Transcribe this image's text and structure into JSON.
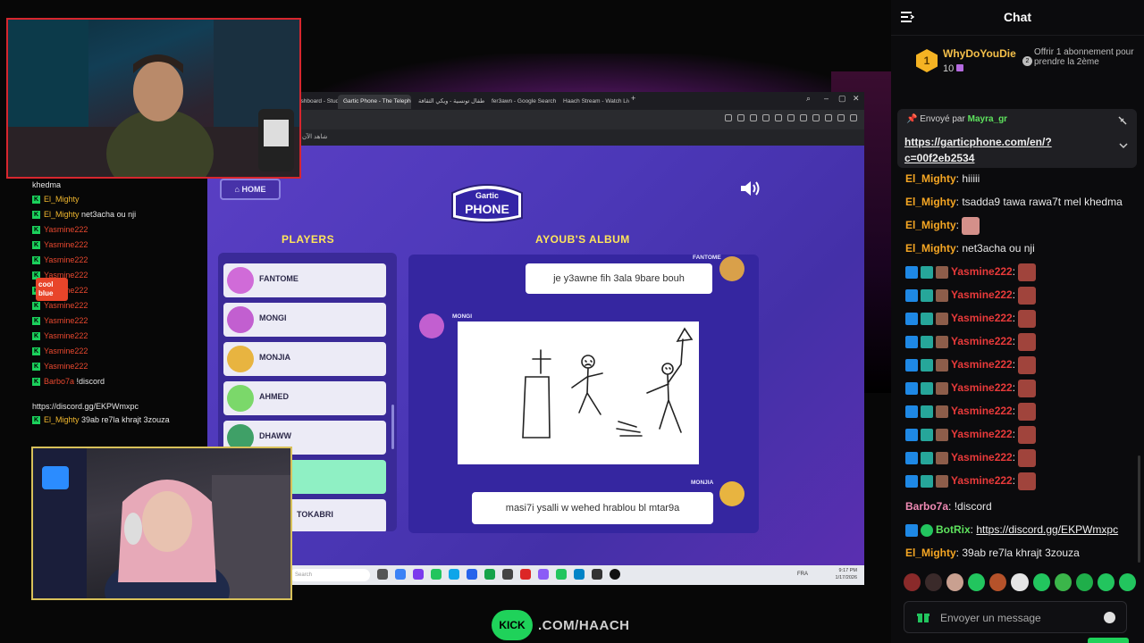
{
  "browser": {
    "tabs": [
      {
        "label": "Twitch Dashboard - Studio for store"
      },
      {
        "label": "Gartic Phone - The Telephone Game"
      },
      {
        "label": "أطفال تونسية - ويكي الثقافة"
      },
      {
        "label": "fer3awn - Google Search"
      },
      {
        "label": "Haach Stream - Watch Live"
      }
    ],
    "bookmark": "شاهد الآن"
  },
  "game": {
    "home_label": "HOME",
    "logo_top": "Gartic",
    "logo_bottom": "PHONE",
    "players_header": "PLAYERS",
    "album_header": "AYOUB'S ALBUM",
    "players": [
      {
        "name": "FANTOME",
        "color": "#d06bd8"
      },
      {
        "name": "MONGI",
        "color": "#c25fd0"
      },
      {
        "name": "MONJIA",
        "color": "#e8b440"
      },
      {
        "name": "AHMED",
        "color": "#7bd86a"
      },
      {
        "name": "DHAWW",
        "color": "#3fa067"
      },
      {
        "name": "",
        "color": "#8ff0c4"
      },
      {
        "name": "TOKABRI",
        "color": "#d9a04a"
      }
    ],
    "album": {
      "top_name": "FANTOME",
      "top_text": "je y3awne fih 3ala 9bare bouh",
      "mid_name": "MONGI",
      "bottom_name": "MONJIA",
      "bottom_text": "masi7i ysalli w wehed hrablou bl mtar9a"
    }
  },
  "taskbar": {
    "search_placeholder": "Search",
    "lang": "FRA",
    "time": "9:17 PM",
    "date": "1/17/2026"
  },
  "overlay_chat": [
    {
      "user": "",
      "text": "khedma"
    },
    {
      "user": "El_Mighty",
      "text": ""
    },
    {
      "user": "El_Mighty",
      "text": "net3acha ou nji"
    },
    {
      "user": "Yasmine222",
      "text": ""
    },
    {
      "user": "Yasmine222",
      "text": ""
    },
    {
      "user": "Yasmine222",
      "text": ""
    },
    {
      "user": "Yasmine222",
      "text": ""
    },
    {
      "user": "Yasmine222",
      "text": ""
    },
    {
      "user": "Yasmine222",
      "text": ""
    },
    {
      "user": "Yasmine222",
      "text": ""
    },
    {
      "user": "Yasmine222",
      "text": ""
    },
    {
      "user": "Yasmine222",
      "text": ""
    },
    {
      "user": "Yasmine222",
      "text": ""
    },
    {
      "user": "Barbo7a",
      "text": "!discord"
    },
    {
      "user": "",
      "text": "https://discord.gg/EKPWmxpc"
    },
    {
      "user": "El_Mighty",
      "text": "39ab re7la khrajt 3zouza"
    }
  ],
  "overlay_ad": "cool blue",
  "branding": {
    "logo": "KICK",
    "url": ".COM/HAACH"
  },
  "chat": {
    "title": "Chat",
    "top_sub": {
      "rank": "1",
      "user": "WhyDoYouDie",
      "count": "10",
      "gift_num": "2",
      "gift_text": "Offrir 1 abonnement pour prendre la 2ème"
    },
    "pinned": {
      "label": "Envoyé par",
      "user": "Mayra_gr",
      "link": "https://garticphone.com/en/?c=00f2eb2534"
    },
    "messages": [
      {
        "user": "El_Mighty",
        "text": "hiiiii",
        "cls": "u-orange"
      },
      {
        "user": "El_Mighty",
        "text": "tsadda9 tawa rawa7t mel khedma",
        "cls": "u-orange"
      },
      {
        "user": "El_Mighty",
        "text": "",
        "cls": "u-orange"
      },
      {
        "user": "El_Mighty",
        "text": "net3acha ou nji",
        "cls": "u-orange"
      },
      {
        "user": "Yasmine222",
        "text": "",
        "cls": "u-red"
      },
      {
        "user": "Yasmine222",
        "text": "",
        "cls": "u-red"
      },
      {
        "user": "Yasmine222",
        "text": "",
        "cls": "u-red"
      },
      {
        "user": "Yasmine222",
        "text": "",
        "cls": "u-red"
      },
      {
        "user": "Yasmine222",
        "text": "",
        "cls": "u-red"
      },
      {
        "user": "Yasmine222",
        "text": "",
        "cls": "u-red"
      },
      {
        "user": "Yasmine222",
        "text": "",
        "cls": "u-red"
      },
      {
        "user": "Yasmine222",
        "text": "",
        "cls": "u-red"
      },
      {
        "user": "Yasmine222",
        "text": "",
        "cls": "u-red"
      },
      {
        "user": "Yasmine222",
        "text": "",
        "cls": "u-red"
      },
      {
        "user": "Barbo7a",
        "text": "!discord",
        "cls": "u-pink"
      },
      {
        "user": "BotRix",
        "text": "https://discord.gg/EKPWmxpc",
        "cls": "u-green"
      },
      {
        "user": "El_Mighty",
        "text": "39ab re7la khrajt 3zouza",
        "cls": "u-orange"
      }
    ],
    "input_placeholder": "Envoyer un message"
  }
}
